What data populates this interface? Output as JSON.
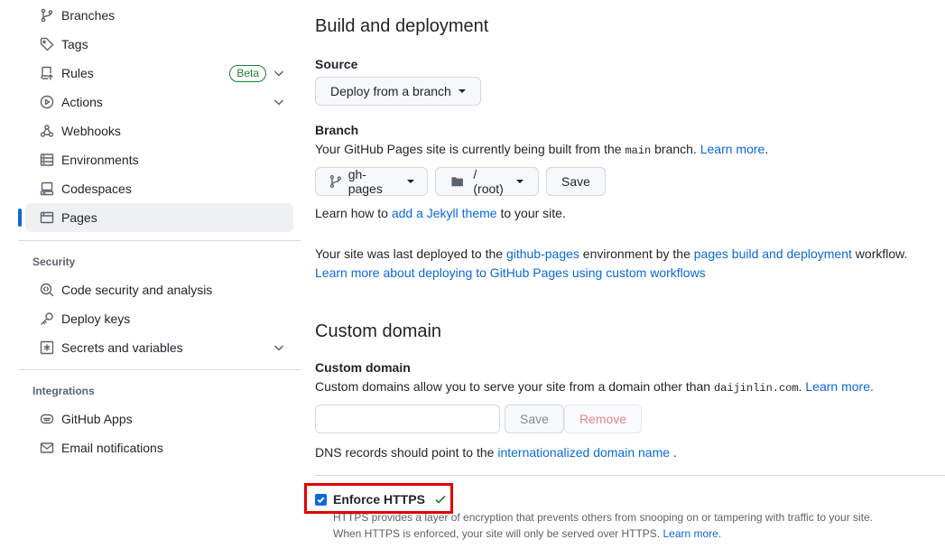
{
  "sidebar": {
    "code_automation_items": [
      {
        "label": "Branches",
        "icon": "git-branch-icon"
      },
      {
        "label": "Tags",
        "icon": "tag-icon"
      },
      {
        "label": "Rules",
        "icon": "repo-push-icon",
        "badge": "Beta"
      },
      {
        "label": "Actions",
        "icon": "play-icon"
      },
      {
        "label": "Webhooks",
        "icon": "webhook-icon"
      },
      {
        "label": "Environments",
        "icon": "server-icon"
      },
      {
        "label": "Codespaces",
        "icon": "codespaces-icon"
      },
      {
        "label": "Pages",
        "icon": "browser-icon",
        "active": true
      }
    ],
    "security_title": "Security",
    "security_items": [
      {
        "label": "Code security and analysis",
        "icon": "codescan-icon"
      },
      {
        "label": "Deploy keys",
        "icon": "key-icon"
      },
      {
        "label": "Secrets and variables",
        "icon": "key-asterisk-icon"
      }
    ],
    "integrations_title": "Integrations",
    "integrations_items": [
      {
        "label": "GitHub Apps",
        "icon": "hubot-icon"
      },
      {
        "label": "Email notifications",
        "icon": "mail-icon"
      }
    ]
  },
  "build": {
    "heading": "Build and deployment",
    "source_label": "Source",
    "source_value": "Deploy from a branch",
    "branch_label": "Branch",
    "branch_desc_pre": "Your GitHub Pages site is currently being built from the ",
    "branch_desc_code": "main",
    "branch_desc_post": " branch. ",
    "learn_more": "Learn more",
    "branch_select": "gh-pages",
    "folder_select": "/ (root)",
    "save": "Save",
    "jekyll_pre": "Learn how to ",
    "jekyll_link": "add a Jekyll theme",
    "jekyll_post": " to your site.",
    "deployed_pre": "Your site was last deployed to the ",
    "deployed_env": "github-pages",
    "deployed_mid": " environment by the ",
    "deployed_workflow": "pages build and deployment",
    "deployed_post": " workflow.",
    "custom_workflows_link": "Learn more about deploying to GitHub Pages using custom workflows"
  },
  "domain": {
    "heading": "Custom domain",
    "label": "Custom domain",
    "desc_pre": "Custom domains allow you to serve your site from a domain other than ",
    "desc_code": "daijinlin.com",
    "desc_post": ". ",
    "learn_more": "Learn more.",
    "input_value": "",
    "save": "Save",
    "remove": "Remove",
    "dns_pre": "DNS records should point to the ",
    "dns_link": "internationalized domain name",
    "dns_post": " ."
  },
  "https": {
    "label": "Enforce HTTPS",
    "checked": true,
    "desc1": "HTTPS provides a layer of encryption that prevents others from snooping on or tampering with traffic to your site.",
    "desc2_pre": "When HTTPS is enforced, your site will only be served over HTTPS. ",
    "learn_more": "Learn more."
  },
  "colors": {
    "accent": "#0969da",
    "success": "#1a7f37",
    "highlight": "#e00000"
  }
}
